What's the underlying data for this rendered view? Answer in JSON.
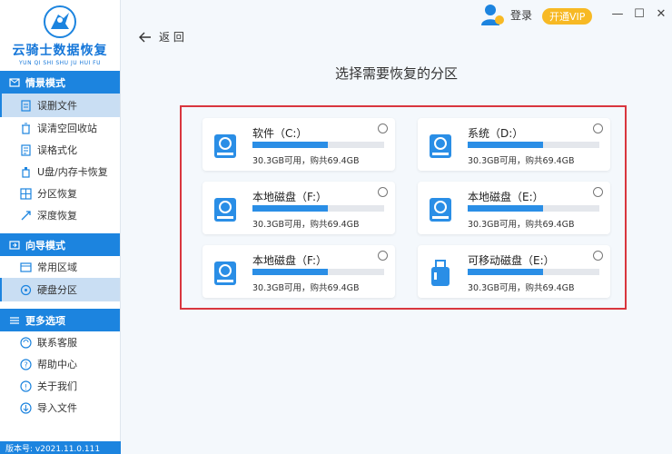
{
  "app": {
    "logo_title": "云骑士数据恢复",
    "logo_subtitle": "YUN QI SHI SHU JU HUI FU",
    "version": "版本号: v2021.11.0.111"
  },
  "header": {
    "login": "登录",
    "vip": "开通VIP",
    "back": "返 回",
    "page_title": "选择需要恢复的分区"
  },
  "sidebar": {
    "sections": [
      {
        "title": "情景模式",
        "items": [
          {
            "label": "误删文件",
            "icon": "file-delete-icon",
            "active": true
          },
          {
            "label": "误清空回收站",
            "icon": "recycle-bin-icon",
            "active": false
          },
          {
            "label": "误格式化",
            "icon": "format-icon",
            "active": false
          },
          {
            "label": "U盘/内存卡恢复",
            "icon": "usb-icon",
            "active": false
          },
          {
            "label": "分区恢复",
            "icon": "partition-icon",
            "active": false
          },
          {
            "label": "深度恢复",
            "icon": "deep-scan-icon",
            "active": false
          }
        ]
      },
      {
        "title": "向导模式",
        "items": [
          {
            "label": "常用区域",
            "icon": "window-icon",
            "active": false
          },
          {
            "label": "硬盘分区",
            "icon": "disk-icon",
            "active": true
          }
        ]
      },
      {
        "title": "更多选项",
        "items": [
          {
            "label": "联系客服",
            "icon": "headset-icon",
            "active": false
          },
          {
            "label": "帮助中心",
            "icon": "help-icon",
            "active": false
          },
          {
            "label": "关于我们",
            "icon": "info-icon",
            "active": false
          },
          {
            "label": "导入文件",
            "icon": "import-icon",
            "active": false
          }
        ]
      }
    ]
  },
  "partitions": [
    {
      "name": "软件（C:）",
      "info": "30.3GB可用，购共69.4GB",
      "used_fraction": 0.57,
      "type": "hdd"
    },
    {
      "name": "系统（D:）",
      "info": "30.3GB可用，购共69.4GB",
      "used_fraction": 0.57,
      "type": "hdd"
    },
    {
      "name": "本地磁盘（F:）",
      "info": "30.3GB可用，购共69.4GB",
      "used_fraction": 0.57,
      "type": "hdd"
    },
    {
      "name": "本地磁盘（E:）",
      "info": "30.3GB可用，购共69.4GB",
      "used_fraction": 0.57,
      "type": "hdd"
    },
    {
      "name": "本地磁盘（F:）",
      "info": "30.3GB可用，购共69.4GB",
      "used_fraction": 0.57,
      "type": "hdd"
    },
    {
      "name": "可移动磁盘（E:）",
      "info": "30.3GB可用，购共69.4GB",
      "used_fraction": 0.57,
      "type": "usb"
    }
  ],
  "colors": {
    "brand": "#1c84df",
    "vip": "#f7b924",
    "highlight_border": "#d9363e",
    "bar_fill": "#2a8ee6"
  }
}
